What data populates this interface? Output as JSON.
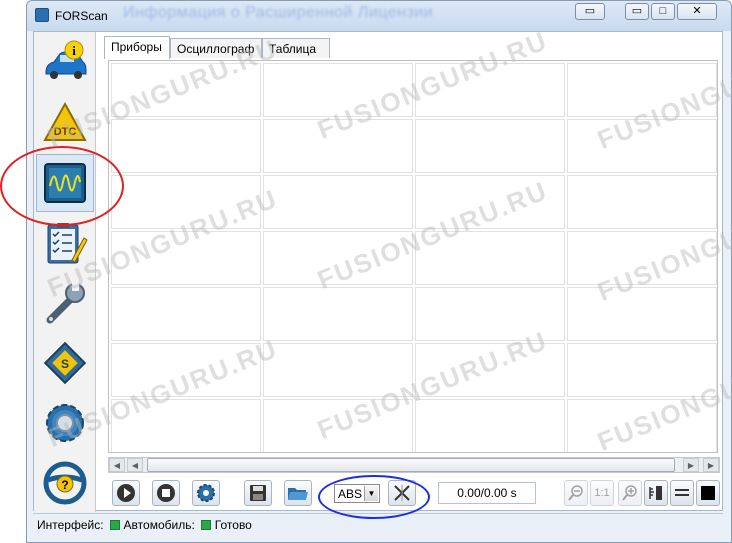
{
  "window": {
    "title": "FORScan",
    "blurred_title": "Информация о Расширенной Лицензии",
    "controls": {
      "restore": "▭",
      "maximize": "□",
      "close": "✕",
      "extra": "▭"
    }
  },
  "sidebar": {
    "items": [
      {
        "name": "vehicle-info",
        "icon": "car-info-icon"
      },
      {
        "name": "dtc",
        "icon": "dtc-warning-icon",
        "label": "DTC"
      },
      {
        "name": "oscilloscope",
        "icon": "oscilloscope-icon"
      },
      {
        "name": "tests",
        "icon": "checklist-icon"
      },
      {
        "name": "service",
        "icon": "wrench-icon"
      },
      {
        "name": "configuration",
        "icon": "chip-icon"
      },
      {
        "name": "settings",
        "icon": "gear-icon"
      },
      {
        "name": "help",
        "icon": "steering-help-icon"
      }
    ]
  },
  "tabs": [
    {
      "label": "Приборы",
      "active": true
    },
    {
      "label": "Осциллограф",
      "active": false
    },
    {
      "label": "Таблица",
      "active": false
    }
  ],
  "toolbar": {
    "module_select": "ABS",
    "timer": "0.00/0.00 s",
    "zoom_ratio": "1:1"
  },
  "status": {
    "interface_label": "Интерфейс:",
    "vehicle_label": "Автомобиль:",
    "ready_label": "Готово",
    "indicator_color": "#29a84a"
  },
  "watermark": "FUSIONGURU.RU"
}
